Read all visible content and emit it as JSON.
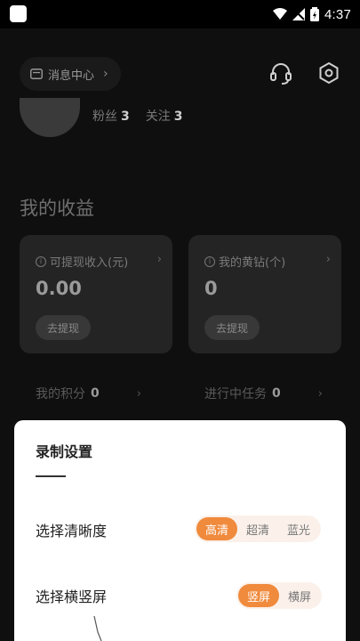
{
  "status_bar": {
    "time": "4:37"
  },
  "header": {
    "message_center_label": "消息中心",
    "chevron": "›"
  },
  "profile": {
    "fans_label": "粉丝",
    "fans_count": "3",
    "follow_label": "关注",
    "follow_count": "3"
  },
  "earnings": {
    "title": "我的收益",
    "cards": [
      {
        "label": "可提现收入(元)",
        "value": "0.00",
        "button": "去提现"
      },
      {
        "label": "我的黄钻(个)",
        "value": "0",
        "button": "去提现"
      }
    ],
    "points_label": "我的积分",
    "points_value": "0",
    "tasks_label": "进行中任务",
    "tasks_value": "0"
  },
  "record_settings": {
    "title": "录制设置",
    "clarity_label": "选择清晰度",
    "clarity_options": [
      "高清",
      "超清",
      "蓝光"
    ],
    "clarity_selected": "高清",
    "orientation_label": "选择横竖屏",
    "orientation_options": [
      "竖屏",
      "横屏"
    ],
    "orientation_selected": "竖屏"
  },
  "icons": {
    "message": "mail-icon",
    "support": "headset-icon",
    "settings": "hexagon-gear-icon",
    "info": "info-icon"
  },
  "colors": {
    "accent": "#f08a3c",
    "accent_soft": "#fbf1ea",
    "background": "#0f0f0f",
    "card": "#242424"
  }
}
